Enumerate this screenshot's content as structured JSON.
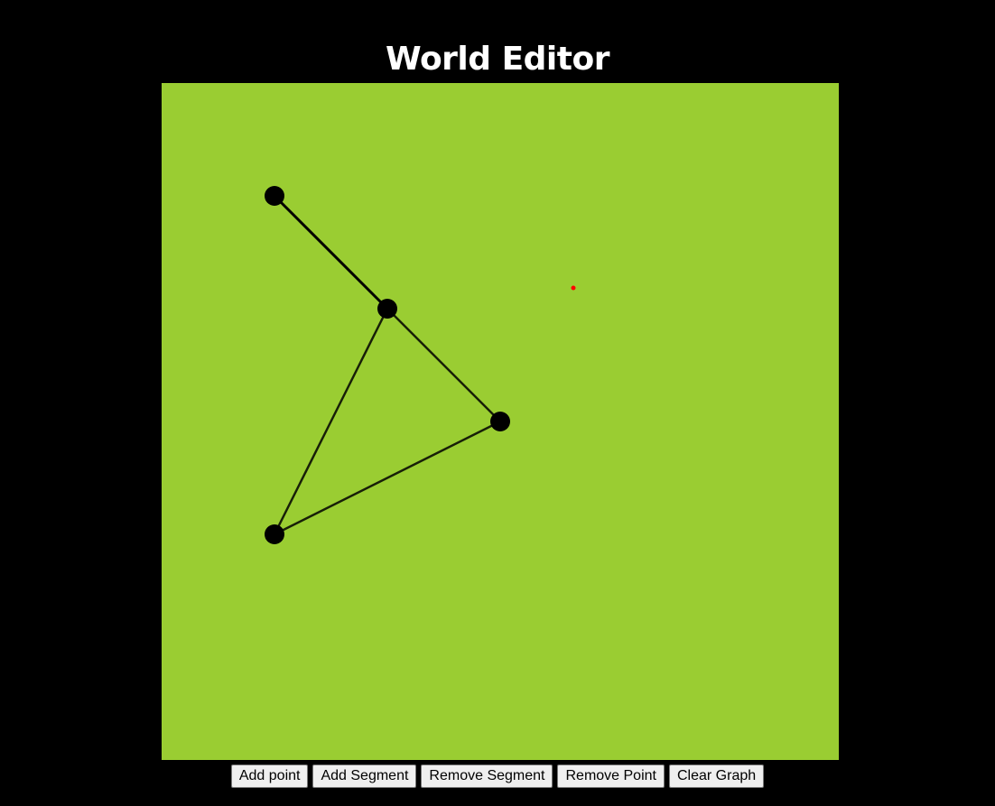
{
  "page": {
    "title": "World Editor"
  },
  "canvas": {
    "background": "#9ACD32",
    "point_color": "#000000",
    "segment_color": "#000000",
    "cursor_dot_color": "#ff0000"
  },
  "toolbar": {
    "add_point_label": "Add point",
    "add_segment_label": "Add Segment",
    "remove_segment_label": "Remove Segment",
    "remove_point_label": "Remove Point",
    "clear_graph_label": "Clear Graph"
  }
}
